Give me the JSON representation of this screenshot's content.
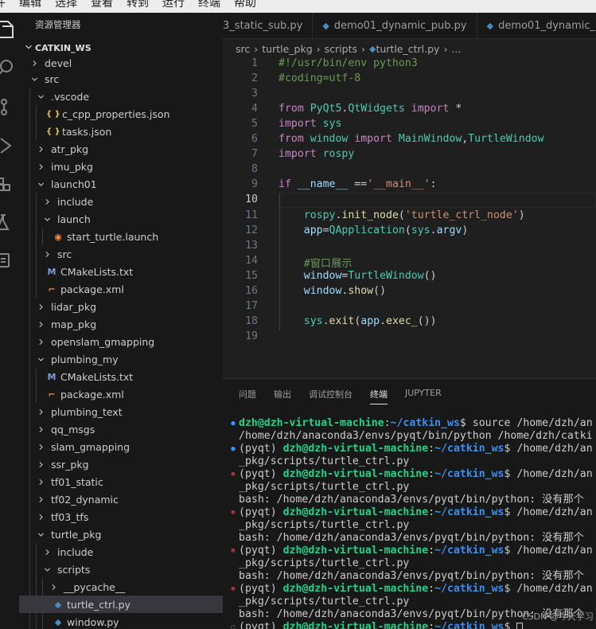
{
  "menu": [
    "件",
    "编辑",
    "选择",
    "查看",
    "转到",
    "运行",
    "终端",
    "帮助"
  ],
  "activity_icons": [
    "files-icon",
    "search-icon",
    "source-control-icon",
    "run-debug-icon",
    "extensions-icon",
    "testing-icon",
    "remote-explorer-icon"
  ],
  "sidebar": {
    "title": "资源管理器",
    "workspace": "CATKIN_WS",
    "tree": [
      {
        "label": "devel",
        "depth": 1,
        "kind": "folder",
        "open": false
      },
      {
        "label": "src",
        "depth": 1,
        "kind": "folder",
        "open": true
      },
      {
        "label": ".vscode",
        "depth": 2,
        "kind": "folder",
        "open": true
      },
      {
        "label": "c_cpp_properties.json",
        "depth": 3,
        "kind": "json"
      },
      {
        "label": "tasks.json",
        "depth": 3,
        "kind": "json"
      },
      {
        "label": "atr_pkg",
        "depth": 2,
        "kind": "folder",
        "open": false
      },
      {
        "label": "imu_pkg",
        "depth": 2,
        "kind": "folder",
        "open": false
      },
      {
        "label": "launch01",
        "depth": 2,
        "kind": "folder",
        "open": true
      },
      {
        "label": "include",
        "depth": 3,
        "kind": "folder",
        "open": false
      },
      {
        "label": "launch",
        "depth": 3,
        "kind": "folder",
        "open": true
      },
      {
        "label": "start_turtle.launch",
        "depth": 4,
        "kind": "launch"
      },
      {
        "label": "src",
        "depth": 3,
        "kind": "folder",
        "open": false
      },
      {
        "label": "CMakeLists.txt",
        "depth": 3,
        "kind": "cmake"
      },
      {
        "label": "package.xml",
        "depth": 3,
        "kind": "xml"
      },
      {
        "label": "lidar_pkg",
        "depth": 2,
        "kind": "folder",
        "open": false
      },
      {
        "label": "map_pkg",
        "depth": 2,
        "kind": "folder",
        "open": false
      },
      {
        "label": "openslam_gmapping",
        "depth": 2,
        "kind": "folder",
        "open": false
      },
      {
        "label": "plumbing_my",
        "depth": 2,
        "kind": "folder",
        "open": true
      },
      {
        "label": "CMakeLists.txt",
        "depth": 3,
        "kind": "cmake"
      },
      {
        "label": "package.xml",
        "depth": 3,
        "kind": "xml"
      },
      {
        "label": "plumbing_text",
        "depth": 2,
        "kind": "folder",
        "open": false
      },
      {
        "label": "qq_msgs",
        "depth": 2,
        "kind": "folder",
        "open": false
      },
      {
        "label": "slam_gmapping",
        "depth": 2,
        "kind": "folder",
        "open": false
      },
      {
        "label": "ssr_pkg",
        "depth": 2,
        "kind": "folder",
        "open": false
      },
      {
        "label": "tf01_static",
        "depth": 2,
        "kind": "folder",
        "open": false
      },
      {
        "label": "tf02_dynamic",
        "depth": 2,
        "kind": "folder",
        "open": false
      },
      {
        "label": "tf03_tfs",
        "depth": 2,
        "kind": "folder",
        "open": false
      },
      {
        "label": "turtle_pkg",
        "depth": 2,
        "kind": "folder",
        "open": true
      },
      {
        "label": "include",
        "depth": 3,
        "kind": "folder",
        "open": false
      },
      {
        "label": "scripts",
        "depth": 3,
        "kind": "folder",
        "open": true
      },
      {
        "label": "__pycache__",
        "depth": 4,
        "kind": "folder",
        "open": false
      },
      {
        "label": "turtle_ctrl.py",
        "depth": 4,
        "kind": "py",
        "selected": true
      },
      {
        "label": "window.py",
        "depth": 4,
        "kind": "py"
      }
    ]
  },
  "tabs": [
    {
      "label": "3_static_sub.py",
      "icon": false
    },
    {
      "label": "demo01_dynamic_pub.py",
      "icon": true
    },
    {
      "label": "demo01_dynamic_",
      "icon": true
    }
  ],
  "breadcrumb": [
    "src",
    "turtle_pkg",
    "scripts",
    "turtle_ctrl.py",
    "..."
  ],
  "editor": {
    "active_line": 10,
    "lines": [
      [
        [
          "cm",
          "#!/usr/bin/env python3"
        ]
      ],
      [
        [
          "cm",
          "#coding=utf-8"
        ]
      ],
      [],
      [
        [
          "kw",
          "from "
        ],
        [
          "tp",
          "PyQt5"
        ],
        [
          "df",
          "."
        ],
        [
          "tp",
          "QtWidgets"
        ],
        [
          "kw",
          " import"
        ],
        [
          "df",
          " *"
        ]
      ],
      [
        [
          "kw",
          "import "
        ],
        [
          "tp",
          "sys"
        ]
      ],
      [
        [
          "kw",
          "from "
        ],
        [
          "tp",
          "window"
        ],
        [
          "kw",
          " import "
        ],
        [
          "tp",
          "MainWindow"
        ],
        [
          "df",
          ","
        ],
        [
          "tp",
          "TurtleWindow"
        ]
      ],
      [
        [
          "kw",
          "import "
        ],
        [
          "tp",
          "rospy"
        ]
      ],
      [],
      [
        [
          "kw",
          "if "
        ],
        [
          "vr",
          "__name__"
        ],
        [
          "df",
          " =="
        ],
        [
          "st",
          "'__main__'"
        ],
        [
          "df",
          ":"
        ]
      ],
      [],
      [
        [
          "df",
          "    "
        ],
        [
          "tp",
          "rospy"
        ],
        [
          "df",
          "."
        ],
        [
          "fn",
          "init_node"
        ],
        [
          "df",
          "("
        ],
        [
          "st",
          "'turtle_ctrl_node'"
        ],
        [
          "df",
          ")"
        ]
      ],
      [
        [
          "df",
          "    "
        ],
        [
          "vr",
          "app"
        ],
        [
          "df",
          "="
        ],
        [
          "tp",
          "QApplication"
        ],
        [
          "df",
          "("
        ],
        [
          "tp",
          "sys"
        ],
        [
          "df",
          "."
        ],
        [
          "vr",
          "argv"
        ],
        [
          "df",
          ")"
        ]
      ],
      [],
      [
        [
          "df",
          "    "
        ],
        [
          "cm",
          "#窗口展示"
        ]
      ],
      [
        [
          "df",
          "    "
        ],
        [
          "vr",
          "window"
        ],
        [
          "df",
          "="
        ],
        [
          "tp",
          "TurtleWindow"
        ],
        [
          "df",
          "()"
        ]
      ],
      [
        [
          "df",
          "    "
        ],
        [
          "vr",
          "window"
        ],
        [
          "df",
          "."
        ],
        [
          "fn",
          "show"
        ],
        [
          "df",
          "()"
        ]
      ],
      [],
      [
        [
          "df",
          "    "
        ],
        [
          "tp",
          "sys"
        ],
        [
          "df",
          "."
        ],
        [
          "fn",
          "exit"
        ],
        [
          "df",
          "("
        ],
        [
          "vr",
          "app"
        ],
        [
          "df",
          "."
        ],
        [
          "fn",
          "exec_"
        ],
        [
          "df",
          "())"
        ]
      ],
      []
    ]
  },
  "panel": {
    "tabs": [
      {
        "label": "问题",
        "active": false
      },
      {
        "label": "输出",
        "active": false
      },
      {
        "label": "调试控制台",
        "active": false
      },
      {
        "label": "终端",
        "active": true
      },
      {
        "label": "JUPYTER",
        "active": false
      }
    ]
  },
  "terminal": [
    {
      "status": "ok",
      "segs": [
        [
          "ug",
          "dzh@dzh-virtual-machine"
        ],
        [
          "df",
          ":"
        ],
        [
          "pa",
          "~/catkin_ws"
        ],
        [
          "df",
          "$ source /home/dzh/an"
        ]
      ]
    },
    {
      "status": "",
      "segs": [
        [
          "df",
          "/home/dzh/anaconda3/envs/pyqt/bin/python /home/dzh/catki"
        ]
      ]
    },
    {
      "status": "ok",
      "segs": [
        [
          "df",
          "(pyqt) "
        ],
        [
          "ug",
          "dzh@dzh-virtual-machine"
        ],
        [
          "df",
          ":"
        ],
        [
          "pa",
          "~/catkin_ws"
        ],
        [
          "df",
          "$ /home/dzh/an"
        ]
      ]
    },
    {
      "status": "",
      "segs": [
        [
          "df",
          "_pkg/scripts/turtle_ctrl.py"
        ]
      ]
    },
    {
      "status": "err",
      "segs": [
        [
          "df",
          "(pyqt) "
        ],
        [
          "ug",
          "dzh@dzh-virtual-machine"
        ],
        [
          "df",
          ":"
        ],
        [
          "pa",
          "~/catkin_ws"
        ],
        [
          "df",
          "$ /home/dzh/an"
        ]
      ]
    },
    {
      "status": "",
      "segs": [
        [
          "df",
          "_pkg/scripts/turtle_ctrl.py"
        ]
      ]
    },
    {
      "status": "",
      "segs": [
        [
          "df",
          "bash: /home/dzh/anaconda3/envs/pyqt/bin/python: 没有那个"
        ]
      ]
    },
    {
      "status": "err",
      "segs": [
        [
          "df",
          "(pyqt) "
        ],
        [
          "ug",
          "dzh@dzh-virtual-machine"
        ],
        [
          "df",
          ":"
        ],
        [
          "pa",
          "~/catkin_ws"
        ],
        [
          "df",
          "$ /home/dzh/an"
        ]
      ]
    },
    {
      "status": "",
      "segs": [
        [
          "df",
          "_pkg/scripts/turtle_ctrl.py"
        ]
      ]
    },
    {
      "status": "",
      "segs": [
        [
          "df",
          "bash: /home/dzh/anaconda3/envs/pyqt/bin/python: 没有那个"
        ]
      ]
    },
    {
      "status": "err",
      "segs": [
        [
          "df",
          "(pyqt) "
        ],
        [
          "ug",
          "dzh@dzh-virtual-machine"
        ],
        [
          "df",
          ":"
        ],
        [
          "pa",
          "~/catkin_ws"
        ],
        [
          "df",
          "$ /home/dzh/an"
        ]
      ]
    },
    {
      "status": "",
      "segs": [
        [
          "df",
          "_pkg/scripts/turtle_ctrl.py"
        ]
      ]
    },
    {
      "status": "",
      "segs": [
        [
          "df",
          "bash: /home/dzh/anaconda3/envs/pyqt/bin/python: 没有那个"
        ]
      ]
    },
    {
      "status": "err",
      "segs": [
        [
          "df",
          "(pyqt) "
        ],
        [
          "ug",
          "dzh@dzh-virtual-machine"
        ],
        [
          "df",
          ":"
        ],
        [
          "pa",
          "~/catkin_ws"
        ],
        [
          "df",
          "$ /home/dzh/an"
        ]
      ]
    },
    {
      "status": "",
      "segs": [
        [
          "df",
          "_pkg/scripts/turtle_ctrl.py"
        ]
      ]
    },
    {
      "status": "",
      "segs": [
        [
          "df",
          "bash: /home/dzh/anaconda3/envs/pyqt/bin/python: 没有那个"
        ]
      ]
    },
    {
      "status": "none",
      "segs": [
        [
          "df",
          "(pyqt) "
        ],
        [
          "ug",
          "dzh@dzh-virtual-machine"
        ],
        [
          "df",
          ":"
        ],
        [
          "pa",
          "~/catkin_ws"
        ],
        [
          "df",
          "$ "
        ]
      ],
      "cursor": true
    }
  ],
  "watermark": "CSDN @今天学习",
  "colors": {
    "accent": "#3794ff",
    "error": "#f14c4c",
    "user": "#23d18b",
    "path": "#3b8eea"
  }
}
